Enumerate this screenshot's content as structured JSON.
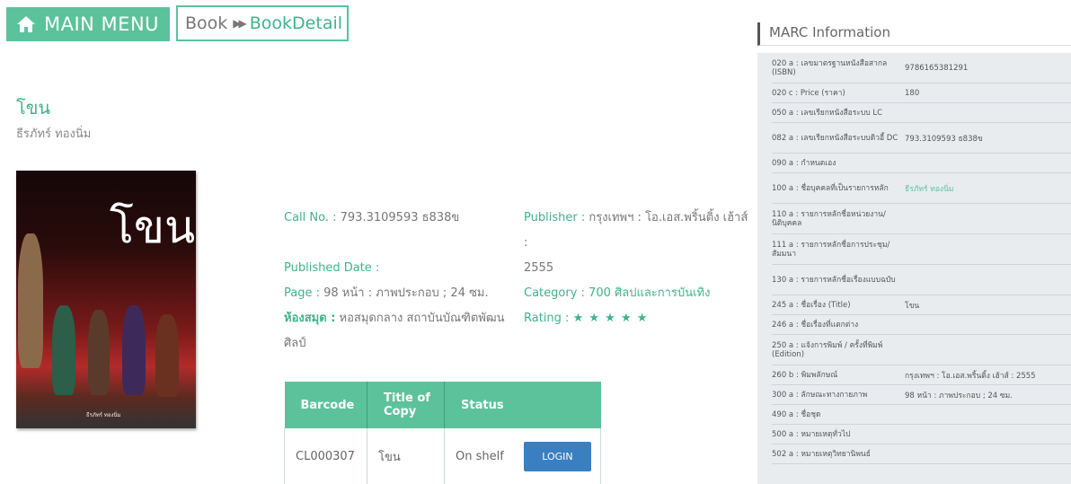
{
  "nav": {
    "main_menu": "MAIN MENU",
    "breadcrumb_book": "Book",
    "breadcrumb_detail": "BookDetail"
  },
  "book": {
    "title": "โขน",
    "author": "ธีรภัทร์ ทองนิ่ม",
    "cover_title": "โขน",
    "cover_author": "ธีรภัทร์ ทองนิ่ม"
  },
  "details": {
    "call_no_label": "Call No. :",
    "call_no": "793.3109593 ธ838ข",
    "published_date_label": "Published Date :",
    "published_date": "",
    "page_label": "Page :",
    "page": "98 หน้า : ภาพประกอบ ; 24 ซม.",
    "library_label": "ห้องสมุด :",
    "library_line1": "หอสมุดกลาง สถาบันบัณฑิตพัฒน",
    "library_line2": "ศิลป์",
    "publisher_label": "Publisher :",
    "publisher_line1": "กรุงเทพฯ : โอ.เอส.พริ้นติ้ง เฮ้าส์ :",
    "publisher_line2": "2555",
    "category_label": "Category :",
    "category": "700 ศิลปและการบันเทิง",
    "rating_label": "Rating :",
    "rating_stars": "★ ★ ★ ★ ★"
  },
  "copies": {
    "headers": [
      "Barcode",
      "Title of Copy",
      "Status"
    ],
    "rows": [
      {
        "barcode": "CL000307",
        "title": "โขน",
        "status": "On shelf",
        "action": "LOGIN"
      }
    ]
  },
  "marc": {
    "header": "MARC Information",
    "rows": [
      {
        "k": "020 a : เลขมาตรฐานหนังสือสากล (ISBN)",
        "v": "9786165381291"
      },
      {
        "k": "020 c : Price (ราคา)",
        "v": "180"
      },
      {
        "k": "050 a : เลขเรียกหนังสือระบบ LC",
        "v": ""
      },
      {
        "k": "082 a : เลขเรียกหนังสือระบบดิวอี้ DC",
        "v": "793.3109593 ธ838ข"
      },
      {
        "k": "090 a : กำหนดเอง",
        "v": ""
      },
      {
        "k": "100 a : ชื่อบุคคลที่เป็นรายการหลัก",
        "v": "ธีรภัทร์ ทองนิ่ม"
      },
      {
        "k": "110 a : รายการหลักชื่อหน่วยงาน/นิติบุคคล",
        "v": ""
      },
      {
        "k": "111 a : รายการหลักชื่อการประชุม/สัมมนา",
        "v": ""
      },
      {
        "k": "130 a : รายการหลักชื่อเรื่องแบบฉบับ",
        "v": ""
      },
      {
        "k": "245 a : ชื่อเรื่อง (Title)",
        "v": "โขน"
      },
      {
        "k": "246 a : ชื่อเรื่องที่แตกต่าง",
        "v": ""
      },
      {
        "k": "250 a : แจ้งการพิมพ์ / ครั้งที่พิมพ์ (Edition)",
        "v": ""
      },
      {
        "k": "260 b : พิมพลักษณ์",
        "v": "กรุงเทพฯ : โอ.เอส.พริ้นติ้ง เฮ้าส์ : 2555"
      },
      {
        "k": "300 a : ลักษณะทางกายภาพ",
        "v": "98 หน้า : ภาพประกอบ ; 24 ซม."
      },
      {
        "k": "490 a : ชื่อชุด",
        "v": ""
      },
      {
        "k": "500 a : หมายเหตุทั่วไป",
        "v": ""
      },
      {
        "k": "502 a : หมายเหตุวิทยานิพนธ์",
        "v": ""
      }
    ]
  },
  "colors": {
    "accent": "#5cc29c",
    "login": "#3a7fbf",
    "marc_bg": "#e9ecef"
  }
}
